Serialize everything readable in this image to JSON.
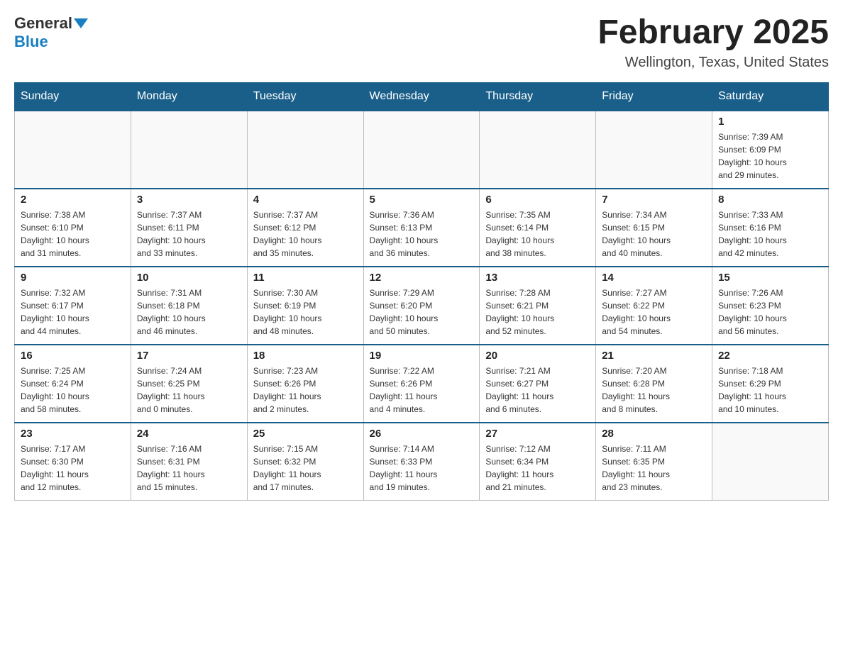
{
  "header": {
    "logo": {
      "general": "General",
      "blue": "Blue"
    },
    "title": "February 2025",
    "location": "Wellington, Texas, United States"
  },
  "weekdays": [
    "Sunday",
    "Monday",
    "Tuesday",
    "Wednesday",
    "Thursday",
    "Friday",
    "Saturday"
  ],
  "weeks": [
    [
      {
        "day": "",
        "info": ""
      },
      {
        "day": "",
        "info": ""
      },
      {
        "day": "",
        "info": ""
      },
      {
        "day": "",
        "info": ""
      },
      {
        "day": "",
        "info": ""
      },
      {
        "day": "",
        "info": ""
      },
      {
        "day": "1",
        "info": "Sunrise: 7:39 AM\nSunset: 6:09 PM\nDaylight: 10 hours\nand 29 minutes."
      }
    ],
    [
      {
        "day": "2",
        "info": "Sunrise: 7:38 AM\nSunset: 6:10 PM\nDaylight: 10 hours\nand 31 minutes."
      },
      {
        "day": "3",
        "info": "Sunrise: 7:37 AM\nSunset: 6:11 PM\nDaylight: 10 hours\nand 33 minutes."
      },
      {
        "day": "4",
        "info": "Sunrise: 7:37 AM\nSunset: 6:12 PM\nDaylight: 10 hours\nand 35 minutes."
      },
      {
        "day": "5",
        "info": "Sunrise: 7:36 AM\nSunset: 6:13 PM\nDaylight: 10 hours\nand 36 minutes."
      },
      {
        "day": "6",
        "info": "Sunrise: 7:35 AM\nSunset: 6:14 PM\nDaylight: 10 hours\nand 38 minutes."
      },
      {
        "day": "7",
        "info": "Sunrise: 7:34 AM\nSunset: 6:15 PM\nDaylight: 10 hours\nand 40 minutes."
      },
      {
        "day": "8",
        "info": "Sunrise: 7:33 AM\nSunset: 6:16 PM\nDaylight: 10 hours\nand 42 minutes."
      }
    ],
    [
      {
        "day": "9",
        "info": "Sunrise: 7:32 AM\nSunset: 6:17 PM\nDaylight: 10 hours\nand 44 minutes."
      },
      {
        "day": "10",
        "info": "Sunrise: 7:31 AM\nSunset: 6:18 PM\nDaylight: 10 hours\nand 46 minutes."
      },
      {
        "day": "11",
        "info": "Sunrise: 7:30 AM\nSunset: 6:19 PM\nDaylight: 10 hours\nand 48 minutes."
      },
      {
        "day": "12",
        "info": "Sunrise: 7:29 AM\nSunset: 6:20 PM\nDaylight: 10 hours\nand 50 minutes."
      },
      {
        "day": "13",
        "info": "Sunrise: 7:28 AM\nSunset: 6:21 PM\nDaylight: 10 hours\nand 52 minutes."
      },
      {
        "day": "14",
        "info": "Sunrise: 7:27 AM\nSunset: 6:22 PM\nDaylight: 10 hours\nand 54 minutes."
      },
      {
        "day": "15",
        "info": "Sunrise: 7:26 AM\nSunset: 6:23 PM\nDaylight: 10 hours\nand 56 minutes."
      }
    ],
    [
      {
        "day": "16",
        "info": "Sunrise: 7:25 AM\nSunset: 6:24 PM\nDaylight: 10 hours\nand 58 minutes."
      },
      {
        "day": "17",
        "info": "Sunrise: 7:24 AM\nSunset: 6:25 PM\nDaylight: 11 hours\nand 0 minutes."
      },
      {
        "day": "18",
        "info": "Sunrise: 7:23 AM\nSunset: 6:26 PM\nDaylight: 11 hours\nand 2 minutes."
      },
      {
        "day": "19",
        "info": "Sunrise: 7:22 AM\nSunset: 6:26 PM\nDaylight: 11 hours\nand 4 minutes."
      },
      {
        "day": "20",
        "info": "Sunrise: 7:21 AM\nSunset: 6:27 PM\nDaylight: 11 hours\nand 6 minutes."
      },
      {
        "day": "21",
        "info": "Sunrise: 7:20 AM\nSunset: 6:28 PM\nDaylight: 11 hours\nand 8 minutes."
      },
      {
        "day": "22",
        "info": "Sunrise: 7:18 AM\nSunset: 6:29 PM\nDaylight: 11 hours\nand 10 minutes."
      }
    ],
    [
      {
        "day": "23",
        "info": "Sunrise: 7:17 AM\nSunset: 6:30 PM\nDaylight: 11 hours\nand 12 minutes."
      },
      {
        "day": "24",
        "info": "Sunrise: 7:16 AM\nSunset: 6:31 PM\nDaylight: 11 hours\nand 15 minutes."
      },
      {
        "day": "25",
        "info": "Sunrise: 7:15 AM\nSunset: 6:32 PM\nDaylight: 11 hours\nand 17 minutes."
      },
      {
        "day": "26",
        "info": "Sunrise: 7:14 AM\nSunset: 6:33 PM\nDaylight: 11 hours\nand 19 minutes."
      },
      {
        "day": "27",
        "info": "Sunrise: 7:12 AM\nSunset: 6:34 PM\nDaylight: 11 hours\nand 21 minutes."
      },
      {
        "day": "28",
        "info": "Sunrise: 7:11 AM\nSunset: 6:35 PM\nDaylight: 11 hours\nand 23 minutes."
      },
      {
        "day": "",
        "info": ""
      }
    ]
  ]
}
